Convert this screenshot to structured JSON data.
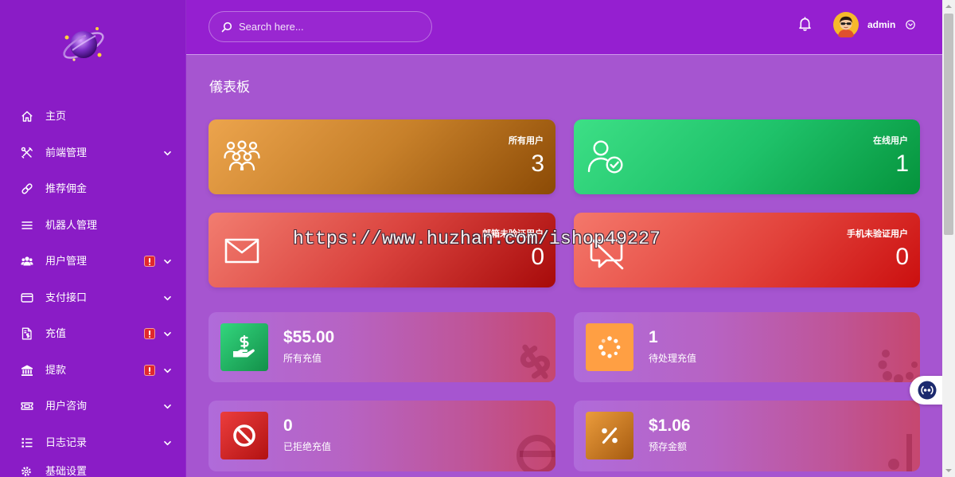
{
  "sidebar": {
    "logo_icon": "planet-logo-icon",
    "items": [
      {
        "label": "主页",
        "icon": "home-icon"
      },
      {
        "label": "前端管理",
        "icon": "tools-icon",
        "submenu": true
      },
      {
        "label": "推荐佣金",
        "icon": "link-icon"
      },
      {
        "label": "机器人管理",
        "icon": "bars-icon"
      },
      {
        "label": "用户管理",
        "icon": "users-icon",
        "submenu": true,
        "alert": true
      },
      {
        "label": "支付接口",
        "icon": "credit-card-icon",
        "submenu": true
      },
      {
        "label": "充值",
        "icon": "file-invoice-dollar-icon",
        "submenu": true,
        "alert": true
      },
      {
        "label": "提款",
        "icon": "bank-icon",
        "submenu": true,
        "alert": true
      },
      {
        "label": "用户咨询",
        "icon": "ticket-icon",
        "submenu": true
      },
      {
        "label": "日志记录",
        "icon": "list-icon",
        "submenu": true
      },
      {
        "label": "基础设置",
        "icon": "gear-icon"
      }
    ]
  },
  "header": {
    "search": {
      "placeholder": "Search here..."
    },
    "notifications_icon": "bell-icon",
    "user": {
      "name": "admin",
      "avatar_icon": "avatar-icon",
      "menu_icon": "chevron-circle-down-icon"
    }
  },
  "page": {
    "title": "儀表板"
  },
  "stat_cards": [
    {
      "label": "所有用户",
      "value": "3",
      "icon": "users-group-icon",
      "color": "#d88a30"
    },
    {
      "label": "在线用户",
      "value": "1",
      "icon": "user-check-icon",
      "color": "#1ec46a"
    },
    {
      "label": "邮箱未验证用户",
      "value": "0",
      "icon": "envelope-icon",
      "color": "#d8403a"
    },
    {
      "label": "手机未验证用户",
      "value": "0",
      "icon": "message-slash-icon",
      "color": "#e03a36"
    }
  ],
  "summary_cards": [
    {
      "value": "$55.00",
      "label": "所有充值",
      "icon": "hand-holding-dollar-icon",
      "color": "#20b862"
    },
    {
      "value": "1",
      "label": "待处理充值",
      "icon": "spinner-icon",
      "color": "#ff9f43"
    },
    {
      "value": "0",
      "label": "已拒绝充值",
      "icon": "ban-icon",
      "color": "#d42828"
    },
    {
      "value": "$1.06",
      "label": "预存金额",
      "icon": "percent-icon",
      "color": "#c8781e"
    }
  ],
  "chat_widget_icon": "chat-bot-icon",
  "watermark": "https://www.huzhan.com/ishop49227",
  "colors": {
    "sidebar": "#8a1cc6",
    "header": "#951fd0",
    "content": "#a655d0",
    "alert": "#e0282d"
  }
}
